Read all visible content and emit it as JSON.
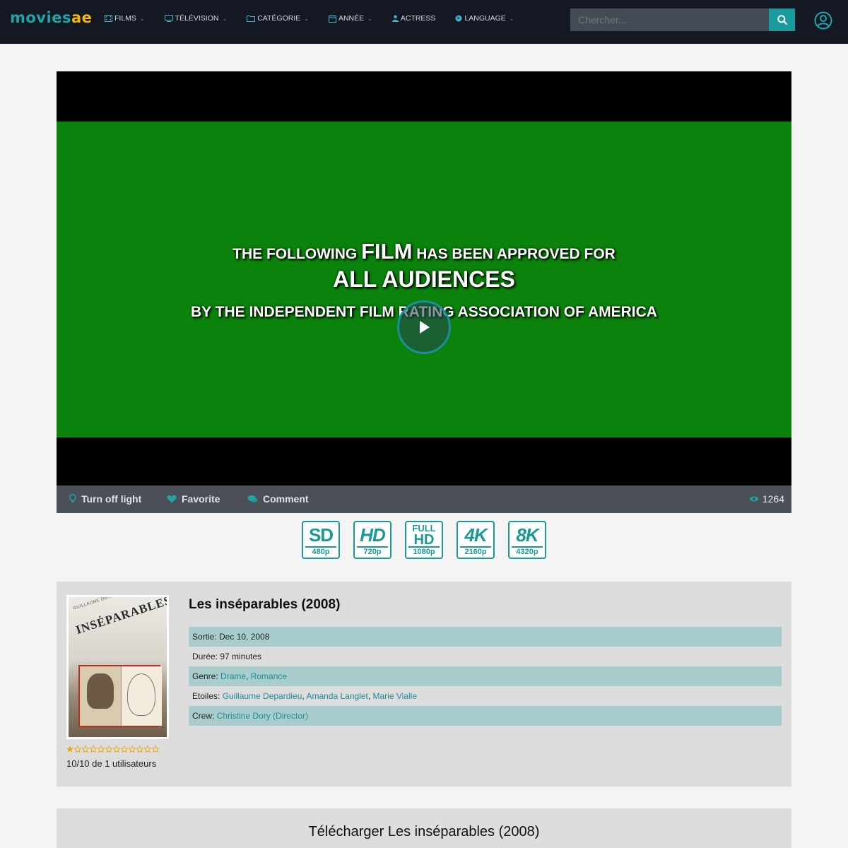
{
  "header": {
    "logo_part1": "movies",
    "logo_part2": "ae",
    "nav": [
      {
        "label": "FILMS",
        "icon": "film-icon"
      },
      {
        "label": "TÉLÉVISION",
        "icon": "tv-icon"
      },
      {
        "label": "CATÉGORIE",
        "icon": "folder-icon"
      },
      {
        "label": "ANNÉE",
        "icon": "calendar-icon"
      },
      {
        "label": "ACTRESS",
        "icon": "user-icon"
      },
      {
        "label": "LANGUAGE",
        "icon": "globe-icon"
      }
    ],
    "search_placeholder": "Chercher...",
    "colors": {
      "header_bg": "#141822",
      "accent": "#199a9c",
      "logo_yellow": "#f2b712"
    }
  },
  "player": {
    "screen_line1_pre": "THE FOLLOWING ",
    "screen_line1_big": "FILM",
    "screen_line1_post": " HAS BEEN APPROVED FOR",
    "screen_line2": "ALL AUDIENCES",
    "screen_line3": "BY THE INDEPENDENT FILM RATING ASSOCIATION OF AMERICA",
    "screen_color": "#0b820b"
  },
  "controls": {
    "light": "Turn off light",
    "favorite": "Favorite",
    "comment": "Comment",
    "views": "1264"
  },
  "qualities": [
    {
      "main": "SD",
      "sub": "480p"
    },
    {
      "main": "HD",
      "sub": "720p"
    },
    {
      "full": "FULL",
      "main": "HD",
      "sub": "1080p"
    },
    {
      "main": "4K",
      "sub": "2160p"
    },
    {
      "main": "8K",
      "sub": "4320p"
    }
  ],
  "movie": {
    "title": "Les inséparables (2008)",
    "poster_title": "INSÉPARABLES",
    "poster_names": "GUILLAUME DEPARDIEU  MARIE VIALLE",
    "rating": {
      "filled_stars": 1,
      "total_stars": 12,
      "text": "10/10 de 1 utilisateurs"
    },
    "release_label": "Sortie: ",
    "release": "Dec 10, 2008",
    "duration_label": "Durée: ",
    "duration": "97 minutes",
    "genre_label": "Genre: ",
    "genres": [
      "Drame",
      "Romance"
    ],
    "stars_label": "Etoiles: ",
    "stars": [
      "Guillaume Depardieu",
      "Amanda Langlet",
      "Marie Vialle"
    ],
    "crew_label": "Crew: ",
    "crew": "Christine Dory (Director)"
  },
  "download": {
    "title": "Télécharger Les inséparables (2008)"
  }
}
